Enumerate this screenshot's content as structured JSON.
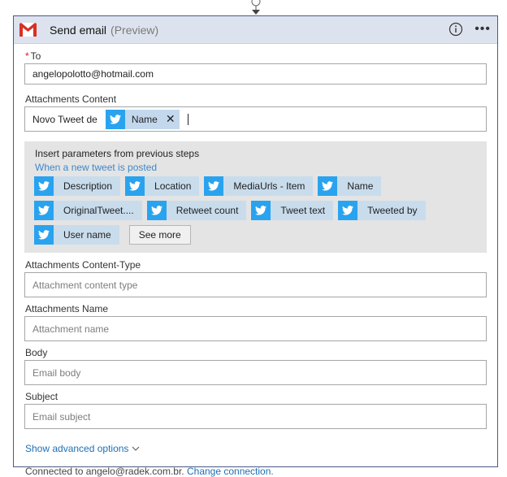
{
  "header": {
    "title": "Send email",
    "subtitle": "(Preview)"
  },
  "fields": {
    "to": {
      "label": "To",
      "value": "angelopolotto@hotmail.com"
    },
    "attachments_content": {
      "label": "Attachments Content",
      "prefix_text": "Novo Tweet de",
      "token": "Name"
    },
    "attachments_content_type": {
      "label": "Attachments Content-Type",
      "placeholder": "Attachment content type"
    },
    "attachments_name": {
      "label": "Attachments Name",
      "placeholder": "Attachment name"
    },
    "body": {
      "label": "Body",
      "placeholder": "Email body"
    },
    "subject": {
      "label": "Subject",
      "placeholder": "Email subject"
    }
  },
  "params_panel": {
    "title": "Insert parameters from previous steps",
    "trigger": "When a new tweet is posted",
    "chips": [
      "Description",
      "Location",
      "MediaUrls - Item",
      "Name",
      "OriginalTweet....",
      "Retweet count",
      "Tweet text",
      "Tweeted by",
      "User name"
    ],
    "see_more": "See more"
  },
  "advanced": {
    "label": "Show advanced options"
  },
  "connection": {
    "prefix": "Connected to angelo@radek.com.br.",
    "link": "Change connection."
  },
  "colors": {
    "twitter": "#2aa3ef",
    "chip_bg": "#c8dcec",
    "link": "#1f6fb4",
    "header_bg": "#dde3ee"
  },
  "icons": [
    "gmail-logo",
    "info-icon",
    "more-icon",
    "twitter-icon",
    "close-icon",
    "chevron-down-icon"
  ]
}
